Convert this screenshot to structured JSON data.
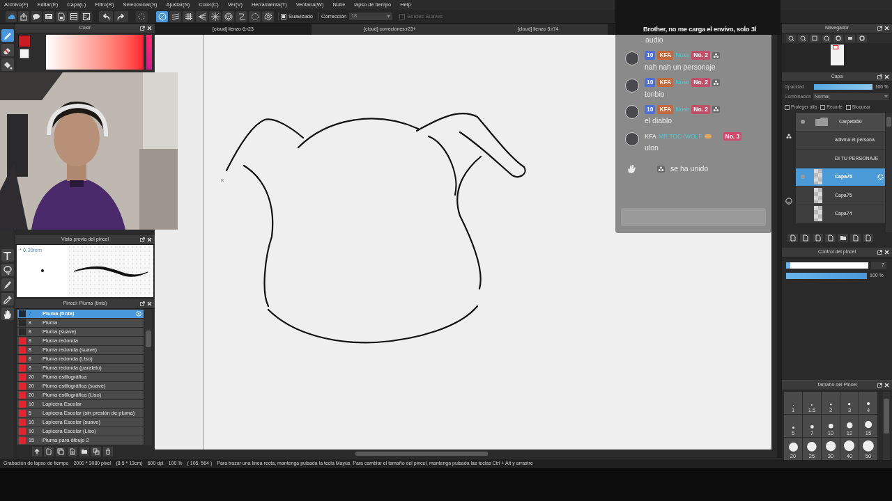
{
  "menu": [
    "Archivo(F)",
    "Editar(E)",
    "Capa(L)",
    "Filtro(R)",
    "Seleccionar(S)",
    "Ajustar(N)",
    "Color(C)",
    "Ver(V)",
    "Herramienta(T)",
    "Ventana(W)",
    "Nube",
    "lapso de tiempo",
    "Help"
  ],
  "toolbar": {
    "ruler_buttons": [
      {
        "kind": "line",
        "selected": true
      },
      {
        "kind": "parallel",
        "selected": false
      },
      {
        "kind": "grid",
        "selected": false
      },
      {
        "kind": "perspective",
        "selected": false
      },
      {
        "kind": "burst",
        "selected": false
      },
      {
        "kind": "concentric",
        "selected": false
      },
      {
        "kind": "curve",
        "selected": false
      },
      {
        "kind": "circle",
        "selected": false
      },
      {
        "kind": "gear",
        "selected": false
      }
    ],
    "smoothing": {
      "label": "Suavizado",
      "checked": true
    },
    "correction": {
      "label": "Corrección",
      "value": "18"
    },
    "soft_edges": {
      "label": "Bordes Suaves",
      "checked": false,
      "disabled": true
    }
  },
  "tools": [
    {
      "kind": "pen",
      "selected": true
    },
    {
      "kind": "eraser",
      "selected": false
    },
    {
      "kind": "fill",
      "selected": false
    },
    {
      "kind": "text",
      "selected": false
    },
    {
      "kind": "lasso",
      "selected": false
    },
    {
      "kind": "marker",
      "selected": false
    },
    {
      "kind": "eyedropper",
      "selected": false
    },
    {
      "kind": "hand",
      "selected": false
    }
  ],
  "color_panel": {
    "title": "Color"
  },
  "canvas_tabs": [
    {
      "label": "[cloud] lienzo 6:r23",
      "selected": true
    },
    {
      "label": "[cloud] correciones:r23+",
      "selected": false
    },
    {
      "label": "[cloud] lienzo 5:r74",
      "selected": false
    }
  ],
  "brush_preview": {
    "title": "Vista previa del pincel",
    "size": "* 0.30mm"
  },
  "brush_list": {
    "title": "Pincel: Pluma (tinta)",
    "items": [
      {
        "size": "7",
        "name": "Pluma (tinta)",
        "color": "#1e2a3a",
        "selected": true
      },
      {
        "size": "8",
        "name": "Pluma",
        "color": "#2a2a2a",
        "selected": false
      },
      {
        "size": "8",
        "name": "Pluma (suave)",
        "color": "#2a2a2a",
        "selected": false
      },
      {
        "size": "8",
        "name": "Pluma redonda",
        "color": "#e0252f",
        "selected": false
      },
      {
        "size": "8",
        "name": "Pluma redonda (suave)",
        "color": "#e0252f",
        "selected": false
      },
      {
        "size": "8",
        "name": "Pluma redonda (Liso)",
        "color": "#e0252f",
        "selected": false
      },
      {
        "size": "8",
        "name": "Pluma redonda (paralelo)",
        "color": "#e0252f",
        "selected": false
      },
      {
        "size": "20",
        "name": "Pluma estilográfica",
        "color": "#e0252f",
        "selected": false
      },
      {
        "size": "20",
        "name": "Pluma estilográfica (suave)",
        "color": "#e0252f",
        "selected": false
      },
      {
        "size": "20",
        "name": "Pluma estilográfica (Liso)",
        "color": "#e0252f",
        "selected": false
      },
      {
        "size": "10",
        "name": "Lapicera Escolar",
        "color": "#e0252f",
        "selected": false
      },
      {
        "size": "5",
        "name": "Lapicera Escolar (sin presión de pluma)",
        "color": "#e0252f",
        "selected": false
      },
      {
        "size": "10",
        "name": "Lapicera Escolar (suave)",
        "color": "#e0252f",
        "selected": false
      },
      {
        "size": "10",
        "name": "Lapicera Escolar (Liso)",
        "color": "#e0252f",
        "selected": false
      },
      {
        "size": "15",
        "name": "Pluma para dibujo 2",
        "color": "#e0252f",
        "selected": false
      }
    ]
  },
  "chat": {
    "first_message": {
      "text": "Brother, no me carga el envívo, solo 3l",
      "continuation": "audio"
    },
    "messages": [
      {
        "kind": "message",
        "role_icon": true,
        "badges": [
          {
            "kind": "pill",
            "text": "10",
            "color": "#4f6fd8"
          },
          {
            "kind": "pill",
            "text": "KFA",
            "color": "#c4683e"
          },
          {
            "kind": "name",
            "text": "Nose",
            "color": "#4fc8d0"
          },
          {
            "kind": "pill",
            "text": "No. 2",
            "color": "#c0506a"
          }
        ],
        "text": "nah nah un personaje"
      },
      {
        "kind": "message",
        "role_icon": true,
        "badges": [
          {
            "kind": "pill",
            "text": "10",
            "color": "#4f6fd8"
          },
          {
            "kind": "pill",
            "text": "KFA",
            "color": "#c4683e"
          },
          {
            "kind": "name",
            "text": "Nose",
            "color": "#4fc8d0"
          },
          {
            "kind": "pill",
            "text": "No. 2",
            "color": "#c0506a"
          }
        ],
        "text": "toribio"
      },
      {
        "kind": "message",
        "role_icon": true,
        "badges": [
          {
            "kind": "pill",
            "text": "10",
            "color": "#4f6fd8"
          },
          {
            "kind": "pill",
            "text": "KFA",
            "color": "#c4683e"
          },
          {
            "kind": "name",
            "text": "Nose",
            "color": "#4fc8d0"
          },
          {
            "kind": "pill",
            "text": "No. 2",
            "color": "#c0506a"
          }
        ],
        "text": "el diablo"
      },
      {
        "kind": "message",
        "role_icon": false,
        "badges": [
          {
            "kind": "plain",
            "text": "KFA",
            "color": "#d8d8d8"
          },
          {
            "kind": "name",
            "text": "MR TOC /WOLF",
            "color": "#4fc8d0"
          },
          {
            "kind": "pill",
            "text": "No. 3",
            "color": "#d04a6a"
          }
        ],
        "text": "ulon"
      },
      {
        "kind": "join",
        "text": "se ha unido"
      }
    ]
  },
  "navigator": {
    "title": "Navegador"
  },
  "layer_panel": {
    "title": "Capa",
    "opacity_label": "Opacidad",
    "opacity": {
      "level": 1.0,
      "reading": "100 %"
    },
    "blend_label": "Combinación",
    "blend_value": "Normal",
    "options": [
      {
        "label": "Proteger alfa",
        "checked": false
      },
      {
        "label": "Recorte",
        "checked": false
      },
      {
        "label": "Bloquear",
        "checked": false
      }
    ],
    "layers": [
      {
        "kind": "folder",
        "name": "Carpeta50",
        "visible": true,
        "selected": false
      },
      {
        "kind": "text",
        "name": "adivina el persona",
        "visible": false,
        "selected": false
      },
      {
        "kind": "text",
        "name": "DI TU PERSONAJE",
        "visible": false,
        "selected": false
      },
      {
        "kind": "raster",
        "name": "Capa76",
        "visible": true,
        "selected": true
      },
      {
        "kind": "raster",
        "name": "Capa75",
        "visible": false,
        "selected": false
      },
      {
        "kind": "raster",
        "name": "Capa74",
        "visible": false,
        "selected": false
      }
    ]
  },
  "brush_control": {
    "title": "Control del pincel",
    "size": {
      "level": 0.05,
      "reading": "7"
    },
    "opacity": {
      "level": 1.0,
      "reading": "100 %"
    }
  },
  "brush_size": {
    "title": "Tamaño del Pincel",
    "sizes": [
      "1",
      "1.5",
      "2",
      "3",
      "4",
      "5",
      "7",
      "10",
      "12",
      "15",
      "20",
      "25",
      "30",
      "40",
      "50"
    ]
  },
  "status_bar": [
    "Grabación de lapso de tiempo",
    "2000 * 3080 pixel",
    "(8.5 * 13cm)",
    "600 dpi",
    "100 %",
    "( 105, 564 )",
    "Para trazar una línea recta, mantenga pulsada la tecla Mayús. Para cambiar el tamaño del pincel, mantenga pulsada las teclas Ctrl + Alt y arrastre"
  ]
}
